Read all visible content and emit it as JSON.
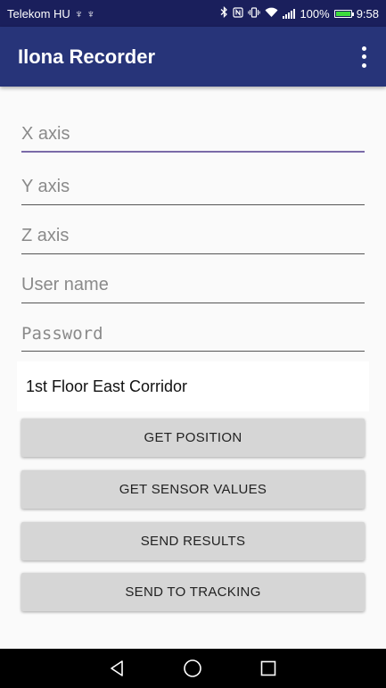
{
  "status_bar": {
    "carrier": "Telekom HU",
    "usb_icons": "♆ ♆",
    "battery_percent": "100%",
    "battery_level": 1.0,
    "time": "9:58"
  },
  "app_bar": {
    "title": "Ilona Recorder",
    "menu_icon": "more-vert-icon"
  },
  "form": {
    "x_axis": {
      "placeholder": "X axis",
      "value": ""
    },
    "y_axis": {
      "placeholder": "Y axis",
      "value": ""
    },
    "z_axis": {
      "placeholder": "Z axis",
      "value": ""
    },
    "username": {
      "placeholder": "User name",
      "value": ""
    },
    "password": {
      "placeholder": "Password",
      "value": ""
    },
    "location": "1st Floor East Corridor"
  },
  "buttons": {
    "get_position": "GET POSITION",
    "get_sensor_values": "GET SENSOR VALUES",
    "send_results": "SEND RESULTS",
    "send_to_tracking": "SEND TO TRACKING"
  },
  "colors": {
    "app_bar": "#273479",
    "status_bar": "#1a1f5c",
    "focus_underline": "#7a6aa8"
  }
}
